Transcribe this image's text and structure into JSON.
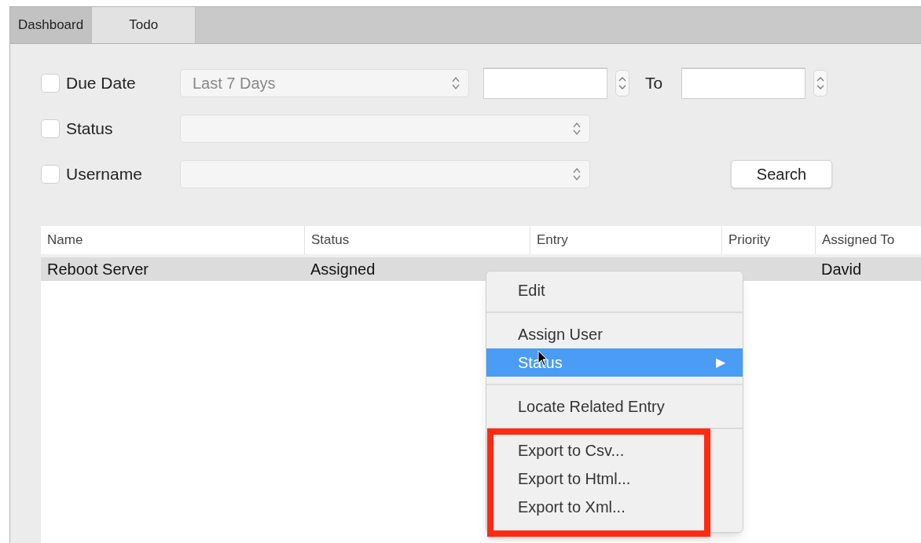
{
  "tabs": [
    {
      "label": "Dashboard",
      "selected": false
    },
    {
      "label": "Todo",
      "selected": true
    }
  ],
  "filters": [
    {
      "label": "Due Date",
      "checked": false,
      "kind": "daterange",
      "select_value": "Last 7 Days",
      "to_label": "To"
    },
    {
      "label": "Status",
      "checked": false,
      "kind": "select"
    },
    {
      "label": "Username",
      "checked": false,
      "kind": "select"
    }
  ],
  "search_button": "Search",
  "table": {
    "columns": [
      "Name",
      "Status",
      "Entry",
      "Priority",
      "Assigned To"
    ],
    "rows": [
      {
        "selected": true,
        "cells": [
          "Reboot Server",
          "Assigned",
          "",
          "",
          "David"
        ]
      }
    ]
  },
  "context_menu": {
    "items": [
      {
        "kind": "item",
        "label": "Edit",
        "selected": false
      },
      {
        "kind": "separator"
      },
      {
        "kind": "item",
        "label": "Assign User",
        "selected": false
      },
      {
        "kind": "submenu",
        "label": "Status",
        "selected": true,
        "arrow": "▶"
      },
      {
        "kind": "separator"
      },
      {
        "kind": "item",
        "label": "Locate Related Entry",
        "selected": false
      },
      {
        "kind": "separator"
      },
      {
        "kind": "item",
        "label": "Export to Csv...",
        "selected": false
      },
      {
        "kind": "item",
        "label": "Export to Html...",
        "selected": false
      },
      {
        "kind": "item",
        "label": "Export to Xml...",
        "selected": false
      }
    ]
  }
}
